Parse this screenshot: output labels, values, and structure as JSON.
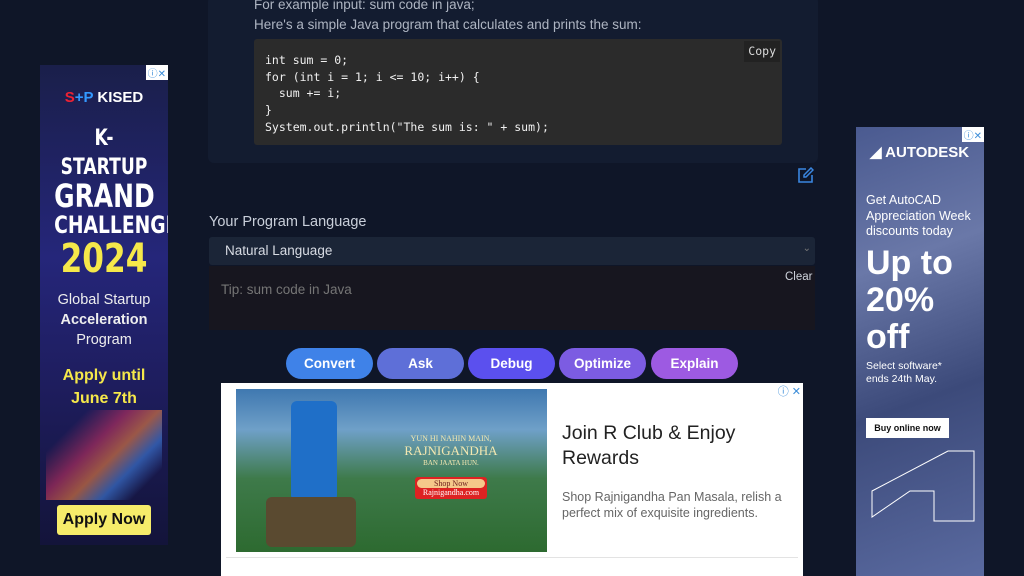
{
  "panel": {
    "example_line": "For example input: sum code in java;",
    "intro_line": "Here's a simple Java program that calculates and prints the sum:",
    "code": "int sum = 0;\nfor (int i = 1; i <= 10; i++) {\n  sum += i;\n}\nSystem.out.println(\"The sum is: \" + sum);",
    "copy_label": "Copy"
  },
  "form": {
    "language_label": "Your Program Language",
    "language_value": "Natural Language",
    "input_placeholder": "Tip: sum code in Java",
    "input_value": "",
    "clear_label": "Clear"
  },
  "actions": [
    {
      "label": "Convert",
      "color": "#3f82e8"
    },
    {
      "label": "Ask",
      "color": "#5e6fd8"
    },
    {
      "label": "Debug",
      "color": "#5b50ee"
    },
    {
      "label": "Optimize",
      "color": "#7c5ce2"
    },
    {
      "label": "Explain",
      "color": "#9d5ae2"
    }
  ],
  "ad_left": {
    "brand": "KISED",
    "lines": [
      "K-STARTUP",
      "GRAND",
      "CHALLENGE",
      "2024"
    ],
    "sub1": "Global Startup",
    "sub2": "Acceleration",
    "sub3": "Program",
    "apply": "Apply until",
    "date": "June 7th",
    "cta": "Apply Now"
  },
  "ad_right": {
    "brand": "AUTODESK",
    "intro": "Get AutoCAD Appreciation Week discounts today",
    "headline1": "Up to",
    "headline2": "20%",
    "headline3": "off",
    "note": "Select software* ends 24th May.",
    "cta": "Buy online now"
  },
  "ad_bottom": {
    "title": "Join R Club & Enjoy Rewards",
    "desc": "Shop Rajnigandha Pan Masala, relish a perfect mix of exquisite ingredients.",
    "image_text1": "YUN HI NAHIN MAIN,",
    "image_text2": "RAJNIGANDHA",
    "image_text3": "BAN JAATA HUN.",
    "image_cta": "Shop Now",
    "image_site": "Rajnigandha.com"
  }
}
